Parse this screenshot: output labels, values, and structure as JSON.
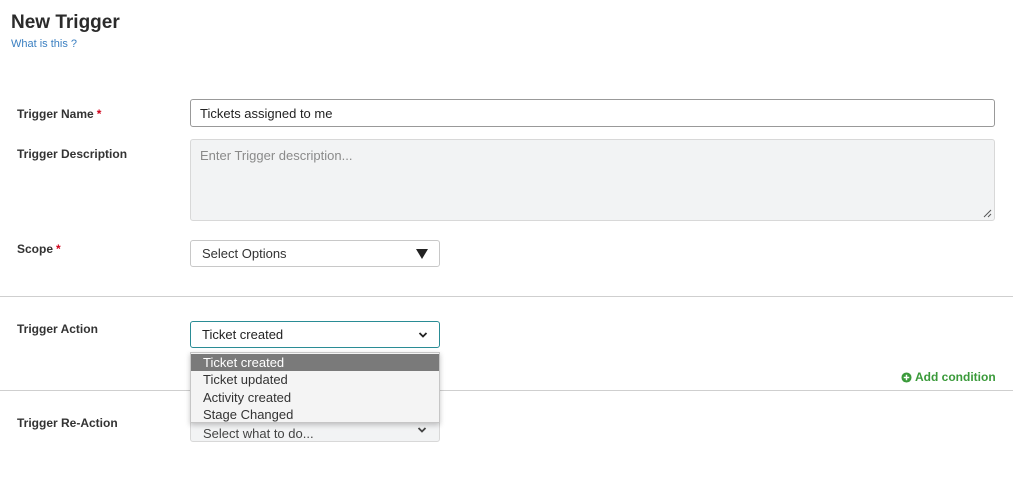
{
  "header": {
    "title": "New Trigger",
    "help_link": "What is this ?"
  },
  "form": {
    "required_mark": "*",
    "trigger_name": {
      "label": "Trigger Name",
      "value": "Tickets assigned to me"
    },
    "trigger_description": {
      "label": "Trigger Description",
      "placeholder": "Enter Trigger description..."
    },
    "scope": {
      "label": "Scope",
      "selected": "Select Options"
    },
    "trigger_action": {
      "label": "Trigger Action",
      "selected": "Ticket created",
      "options": [
        "Ticket created",
        "Ticket updated",
        "Activity created",
        "Stage Changed"
      ],
      "highlighted_index": 0
    },
    "add_condition": "Add condition",
    "trigger_reaction": {
      "label": "Trigger Re-Action",
      "selected": "Select what to do..."
    }
  },
  "colors": {
    "link": "#3a7fc1",
    "required": "#d0021b",
    "accent_green": "#3a9a3a",
    "focus_border": "#2a8c95",
    "option_highlight": "#7a7a7a"
  },
  "icons": {
    "scope_arrow": "triangle-down-icon",
    "action_arrow": "chevron-down-icon",
    "reaction_arrow": "chevron-down-icon",
    "add_condition": "plus-circle-icon",
    "textarea_grip": "resize-grip-icon"
  }
}
